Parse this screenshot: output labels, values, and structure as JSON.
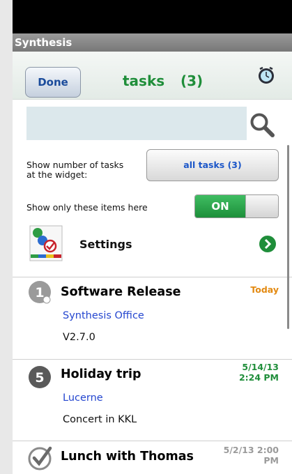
{
  "app": {
    "title": "Synthesis"
  },
  "header": {
    "done_label": "Done",
    "title": "tasks",
    "count": "(3)"
  },
  "search": {
    "value": "",
    "placeholder": ""
  },
  "widget_setting": {
    "label_line1": "Show number of tasks",
    "label_line2": "at the widget:",
    "button_label": "all tasks  (3)"
  },
  "show_only": {
    "label": "Show only these items here",
    "toggle_label": "ON",
    "state": "on"
  },
  "settings": {
    "label": "Settings"
  },
  "tasks": [
    {
      "number": "1",
      "title": "Software Release",
      "place": "Synthesis Office",
      "note": "V2.7.0",
      "date_line1": "Today",
      "date_line2": "",
      "date_color": "#e38a12"
    },
    {
      "number": "5",
      "title": "Holiday trip",
      "place": "Lucerne",
      "note": "Concert in KKL",
      "date_line1": "5/14/13",
      "date_line2": "2:24 PM",
      "date_color": "#1f8e3a"
    },
    {
      "number": "",
      "title": "Lunch with Thomas",
      "place": "",
      "note": "",
      "date_line1": "5/2/13  2:00",
      "date_line2": "PM",
      "date_color": "#9a9a9a"
    }
  ],
  "colors": {
    "accent_green": "#1f8e3a",
    "link_blue": "#2446cf",
    "today_orange": "#e38a12"
  }
}
